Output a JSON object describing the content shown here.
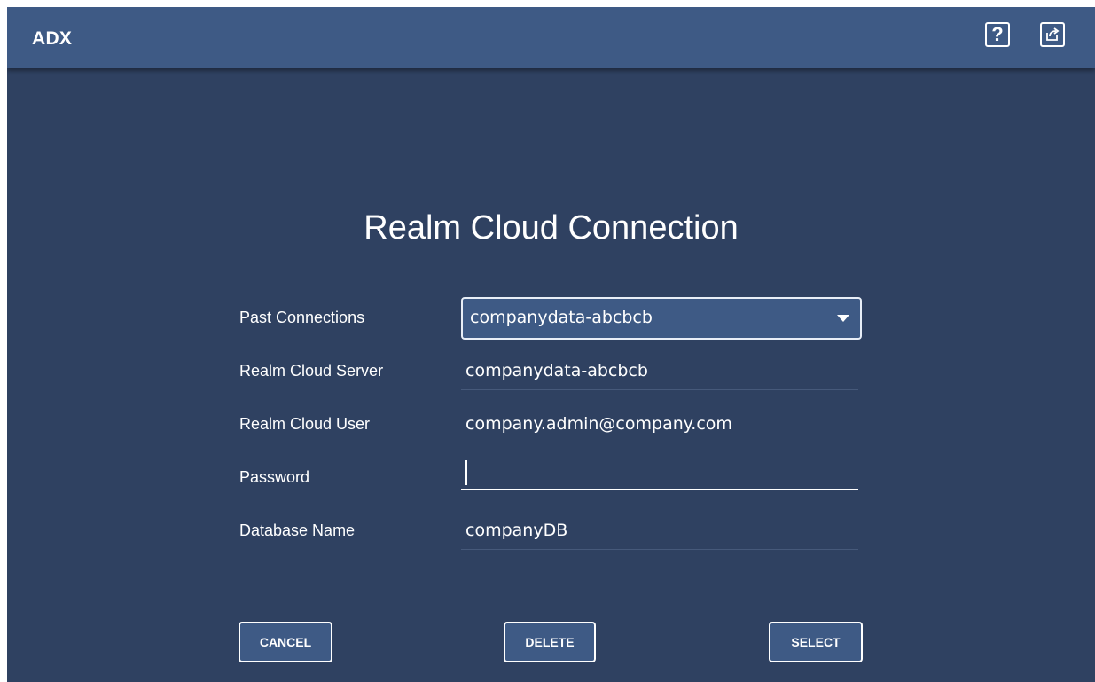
{
  "topbar": {
    "title": "ADX",
    "help_label": "?",
    "help_icon": "help-icon",
    "share_icon": "share-icon"
  },
  "form": {
    "title": "Realm Cloud Connection",
    "past_connections": {
      "label": "Past Connections",
      "selected": "companydata-abcbcb"
    },
    "server": {
      "label": "Realm Cloud Server",
      "value": "companydata-abcbcb"
    },
    "user": {
      "label": "Realm Cloud User",
      "value": "company.admin@company.com"
    },
    "password": {
      "label": "Password",
      "value": ""
    },
    "database": {
      "label": "Database Name",
      "value": "companyDB"
    }
  },
  "buttons": {
    "cancel": "CANCEL",
    "delete": "DELETE",
    "select": "SELECT"
  },
  "colors": {
    "background": "#2f4161",
    "topbar": "#3e5a85",
    "button": "#3e5a85",
    "text": "#ffffff"
  }
}
